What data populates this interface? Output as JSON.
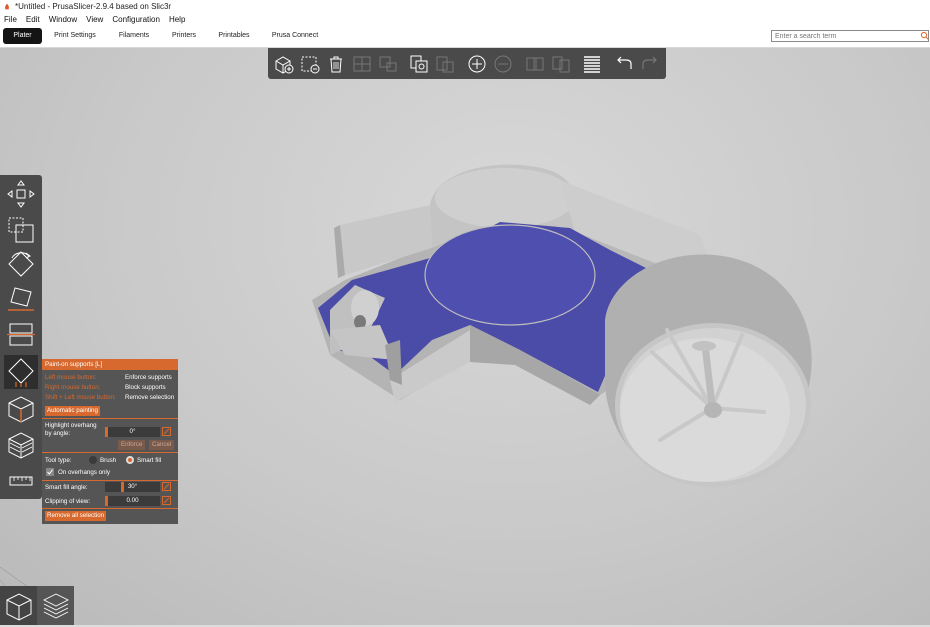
{
  "window": {
    "title": "*Untitled - PrusaSlicer-2.9.4 based on Slic3r"
  },
  "menubar": {
    "items": [
      {
        "label": "File"
      },
      {
        "label": "Edit"
      },
      {
        "label": "Window"
      },
      {
        "label": "View"
      },
      {
        "label": "Configuration"
      },
      {
        "label": "Help"
      }
    ]
  },
  "tabs": [
    {
      "label": "Plater",
      "active": true
    },
    {
      "label": "Print Settings"
    },
    {
      "label": "Filaments"
    },
    {
      "label": "Printers"
    },
    {
      "label": "Printables"
    },
    {
      "label": "Prusa Connect"
    }
  ],
  "search": {
    "placeholder": "Enter a search term",
    "icon": "search-icon"
  },
  "top_toolbar": {
    "icons": [
      "add-object-icon",
      "delete-icon",
      "delete-all-icon",
      "arrange-icon",
      "arrange-selection-icon",
      "copy-icon",
      "paste-icon",
      "add-instance-icon",
      "remove-instance-icon",
      "split-objects-icon",
      "split-parts-icon",
      "layer-editing-icon",
      "undo-icon",
      "redo-icon"
    ]
  },
  "left_toolbar": {
    "icons": [
      "move-icon",
      "scale-icon",
      "rotate-icon",
      "place-on-face-icon",
      "cut-icon",
      "paint-supports-icon",
      "seam-painting-icon",
      "mmu-painting-icon",
      "measure-icon"
    ]
  },
  "paint_panel": {
    "title": "Paint-on supports [L]",
    "hints": [
      {
        "action": "Left mouse button:",
        "effect": "Enforce supports"
      },
      {
        "action": "Right mouse button:",
        "effect": "Block supports"
      },
      {
        "action": "Shift + Left mouse button:",
        "effect": "Remove selection"
      }
    ],
    "auto_button": "Automatic painting",
    "highlight_label_1": "Highlight overhang",
    "highlight_label_2": "by angle:",
    "highlight_value": "0°",
    "enforce_button": "Enforce",
    "cancel_button": "Cancel",
    "tool_type_label": "Tool type:",
    "tool_brush": "Brush",
    "tool_smart_fill": "Smart fill",
    "tool_selected": "Smart fill",
    "overhangs_only": "On overhangs only",
    "overhangs_only_checked": true,
    "smart_fill_label": "Smart fill angle:",
    "smart_fill_value": "30°",
    "clipping_label": "Clipping of view:",
    "clipping_value": "0.00",
    "remove_button": "Remove all selection"
  },
  "view_toggles": [
    "3d-view-icon",
    "preview-icon"
  ],
  "colors": {
    "accent": "#d7692e",
    "paint": "#4b4ba8",
    "model": "#bdbdbd",
    "toolbar": "#4a4a4a"
  }
}
